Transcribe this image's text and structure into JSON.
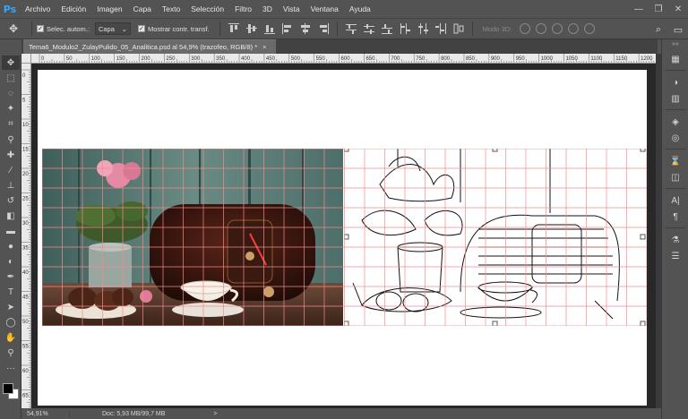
{
  "app": {
    "logo": "Ps"
  },
  "menu": [
    "Archivo",
    "Edición",
    "Imagen",
    "Capa",
    "Texto",
    "Selección",
    "Filtro",
    "3D",
    "Vista",
    "Ventana",
    "Ayuda"
  ],
  "window_controls": [
    "minimize-icon",
    "restore-icon",
    "close-icon"
  ],
  "options": {
    "auto_select_label": "Selec. autom.:",
    "auto_select_value": "Capa",
    "transform_label": "Mostrar contr. transf.",
    "mode3d_label": "Modo 3D:"
  },
  "document": {
    "tab_title": "Tema6_Modulo2_ZulayPulido_05_Analitica.psd al 54,9% (trazofeo, RGB/8) *",
    "close_glyph": "×"
  },
  "ruler": {
    "top_labels": [
      "0",
      "50",
      "100",
      "150",
      "200",
      "250",
      "300",
      "350",
      "400",
      "450",
      "500",
      "550",
      "600",
      "650",
      "700",
      "750",
      "800",
      "850",
      "900",
      "950",
      "1000",
      "1050",
      "1100",
      "1150",
      "1200"
    ],
    "left_labels": [
      "0",
      "5",
      "10",
      "15",
      "20",
      "25",
      "30",
      "35",
      "40",
      "45",
      "50",
      "55",
      "60",
      "65"
    ]
  },
  "status": {
    "zoom": "54,91%",
    "doc_info": "Doc: 5,93 MB/99,7 MB",
    "arrow": ">"
  },
  "colors": {
    "ui_bg": "#535353",
    "ui_dark": "#3a3a3a",
    "canvas_bg": "#282828",
    "grid_line": "#f28b8b",
    "accent": "#31a8ff"
  }
}
